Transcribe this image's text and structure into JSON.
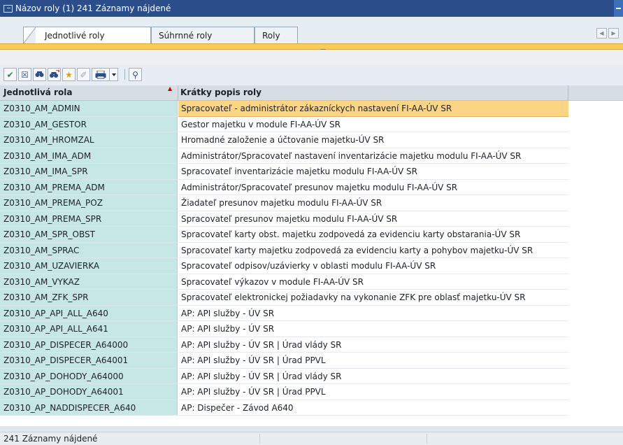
{
  "window": {
    "title": "Názov roly (1)  241 Záznamy nájdené"
  },
  "tabs": [
    {
      "label": "Jednotlivé roly",
      "active": true
    },
    {
      "label": "Súhrnné roly",
      "active": false
    },
    {
      "label": "Roly",
      "active": false
    }
  ],
  "toolbar_icons": [
    "check-icon",
    "cancel-icon",
    "find-icon",
    "find-next-icon",
    "add-favorite-icon",
    "wizard-icon",
    "print-icon",
    "dropdown-icon",
    "pin-icon"
  ],
  "table": {
    "columns": [
      "Jednotlivá rola",
      "Krátky popis roly"
    ],
    "rows": [
      [
        "Z0310_AM_ADMIN",
        "Spracovateľ - administrátor zákazníckych nastavení FI-AA-ÚV SR"
      ],
      [
        "Z0310_AM_GESTOR",
        "Gestor majetku v module FI-AA-ÚV SR"
      ],
      [
        "Z0310_AM_HROMZAL",
        "Hromadné založenie a účtovanie majetku-ÚV SR"
      ],
      [
        "Z0310_AM_IMA_ADM",
        "Administrátor/Spracovateľ nastavení inventarizácie majetku modulu FI-AA-ÚV SR"
      ],
      [
        "Z0310_AM_IMA_SPR",
        "Spracovateľ inventarizácie majetku modulu FI-AA-ÚV SR"
      ],
      [
        "Z0310_AM_PREMA_ADM",
        "Administrátor/Spracovateľ presunov majetku modulu FI-AA-ÚV SR"
      ],
      [
        "Z0310_AM_PREMA_POZ",
        "Žiadateľ presunov majetku modulu FI-AA-ÚV SR"
      ],
      [
        "Z0310_AM_PREMA_SPR",
        "Spracovateľ presunov majetku modulu FI-AA-ÚV SR"
      ],
      [
        "Z0310_AM_SPR_OBST",
        "Spracovateľ karty obst. majetku zodpovedá za evidenciu karty obstarania-ÚV SR"
      ],
      [
        "Z0310_AM_SPRAC",
        "Spracovateľ karty majetku zodpovedá za evidenciu karty a pohybov majetku-ÚV SR"
      ],
      [
        "Z0310_AM_UZAVIERKA",
        "Spracovateľ odpisov/uzávierky v oblasti modulu FI-AA-ÚV SR"
      ],
      [
        "Z0310_AM_VYKAZ",
        "Spracovateľ výkazov v module FI-AA-ÚV SR"
      ],
      [
        "Z0310_AM_ZFK_SPR",
        "Spracovateľ elektronickej požiadavky na vykonanie ZFK pre oblasť majetku-ÚV SR"
      ],
      [
        "Z0310_AP_API_ALL_A640",
        "AP: API služby - ÚV SR"
      ],
      [
        "Z0310_AP_API_ALL_A641",
        "AP: API služby - ÚV SR"
      ],
      [
        "Z0310_AP_DISPECER_A64000",
        "AP: API služby - ÚV SR | Úrad vlády SR"
      ],
      [
        "Z0310_AP_DISPECER_A64001",
        "AP: API služby - ÚV SR | Úrad PPVL"
      ],
      [
        "Z0310_AP_DOHODY_A64000",
        "AP: API služby - ÚV SR | Úrad vlády SR"
      ],
      [
        "Z0310_AP_DOHODY_A64001",
        "AP: API služby - ÚV SR | Úrad PPVL"
      ],
      [
        "Z0310_AP_NADDISPECER_A640",
        "AP: Dispečer - Závod A640"
      ]
    ],
    "selected_row": 0
  },
  "status": {
    "text": "241 Záznamy nájdené"
  }
}
